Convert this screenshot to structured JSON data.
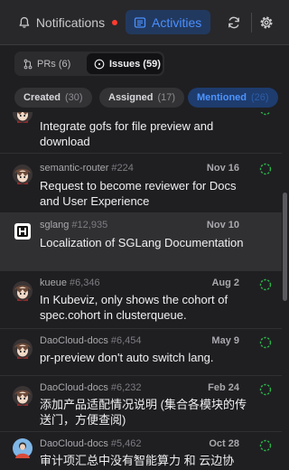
{
  "header": {
    "notifications_label": "Notifications",
    "activities_label": "Activities",
    "colors": {
      "accent": "#4a90ff",
      "unread_dot": "#ff3b30"
    },
    "icons": [
      "bell-icon",
      "inbox-icon",
      "refresh-icon",
      "gear-icon"
    ]
  },
  "segments": {
    "prs": "PRs (6)",
    "issues": "Issues (59)",
    "active": "issues"
  },
  "filters": [
    {
      "label": "Created",
      "count": "(30)",
      "active": false
    },
    {
      "label": "Assigned",
      "count": "(17)",
      "active": false
    },
    {
      "label": "Mentioned",
      "count": "(26)",
      "active": true
    }
  ],
  "items": [
    {
      "repo": "",
      "number": "",
      "date": "",
      "title": "Integrate gofs for file preview and download",
      "avatar": "anime-avatar",
      "status": "open"
    },
    {
      "repo": "semantic-router",
      "number": "#224",
      "date": "Nov 16",
      "title": "Request to become reviewer for Docs and User Experience",
      "avatar": "anime-avatar",
      "status": "open"
    },
    {
      "repo": "sglang",
      "number": "#12,935",
      "date": "Nov 10",
      "title": "Localization of SGLang Documentation",
      "avatar": "sglang-logo",
      "status": "open"
    },
    {
      "repo": "kueue",
      "number": "#6,346",
      "date": "Aug 2",
      "title": "In Kubeviz, only shows the cohort of spec.cohort in clusterqueue.",
      "avatar": "anime-avatar",
      "status": "open"
    },
    {
      "repo": "DaoCloud-docs",
      "number": "#6,454",
      "date": "May 9",
      "title": "pr-preview don't auto switch lang.",
      "avatar": "anime-avatar",
      "status": "open"
    },
    {
      "repo": "DaoCloud-docs",
      "number": "#6,232",
      "date": "Feb 24",
      "title": "添加产品适配情况说明 (集合各模块的传送门，方便查阅)",
      "avatar": "anime-avatar",
      "status": "open"
    },
    {
      "repo": "DaoCloud-docs",
      "number": "#5,462",
      "date": "Oct 28",
      "title": "审计项汇总中没有智能算力 和 云边协同?",
      "avatar": "person-avatar",
      "status": "open"
    }
  ]
}
